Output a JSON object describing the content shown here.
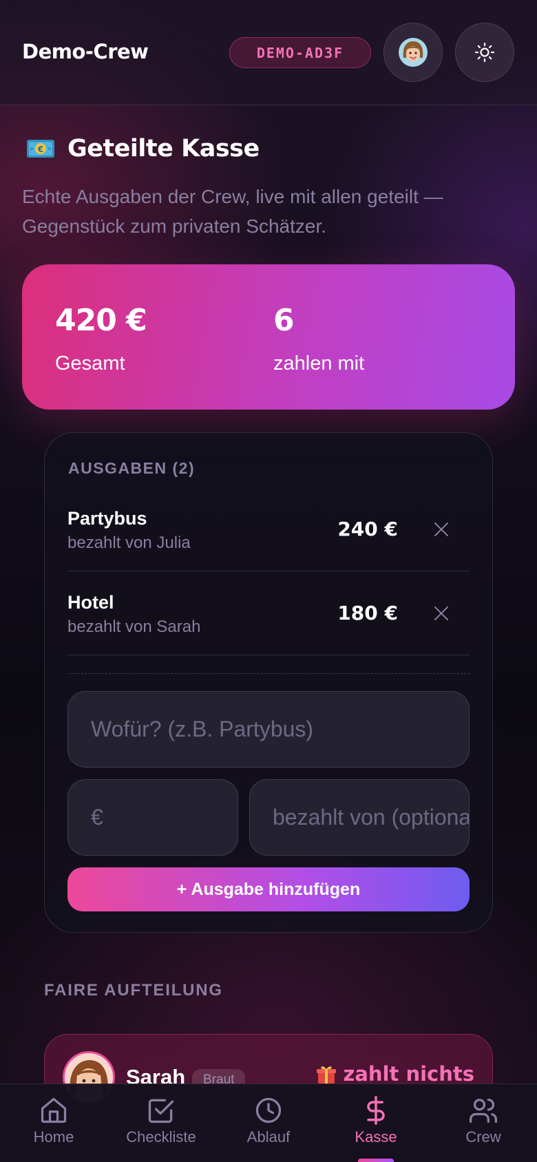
{
  "header": {
    "title": "Demo-Crew",
    "crew_code": "DEMO-AD3F",
    "avatar_icon": "avatar-woman-icon",
    "theme_icon": "sun-icon"
  },
  "kasse": {
    "icon": "money-banknote-icon",
    "title": "Geteilte Kasse",
    "description": "Echte Ausgaben der Crew, live mit allen geteilt — Gegenstück zum privaten Schätzer."
  },
  "summary": {
    "total_value": "420 €",
    "total_label": "Gesamt",
    "payers_value": "6",
    "payers_label": "zahlen mit"
  },
  "expenses": {
    "header": "AUSGABEN (2)",
    "items": [
      {
        "name": "Partybus",
        "payer": "bezahlt von Julia",
        "amount": "240 €"
      },
      {
        "name": "Hotel",
        "payer": "bezahlt von Sarah",
        "amount": "180 €"
      }
    ],
    "form": {
      "what_placeholder": "Wofür? (z.B. Partybus)",
      "amount_placeholder": "€",
      "payer_placeholder": "bezahlt von (optional)",
      "add_label": "+ Ausgabe hinzufügen"
    }
  },
  "split": {
    "header": "FAIRE AUFTEILUNG",
    "items": [
      {
        "name": "Sarah",
        "role": "Braut",
        "status": "zahlt nichts",
        "status_icon": "gift-icon"
      }
    ]
  },
  "nav": {
    "items": [
      {
        "label": "Home",
        "icon": "home-icon"
      },
      {
        "label": "Checkliste",
        "icon": "checklist-icon"
      },
      {
        "label": "Ablauf",
        "icon": "clock-icon"
      },
      {
        "label": "Kasse",
        "icon": "dollar-icon"
      },
      {
        "label": "Crew",
        "icon": "users-icon"
      }
    ],
    "active": "Kasse"
  },
  "colors": {
    "accent_pink": "#ec4899",
    "accent_purple": "#a855f7",
    "muted_text": "#8a7fa1"
  }
}
